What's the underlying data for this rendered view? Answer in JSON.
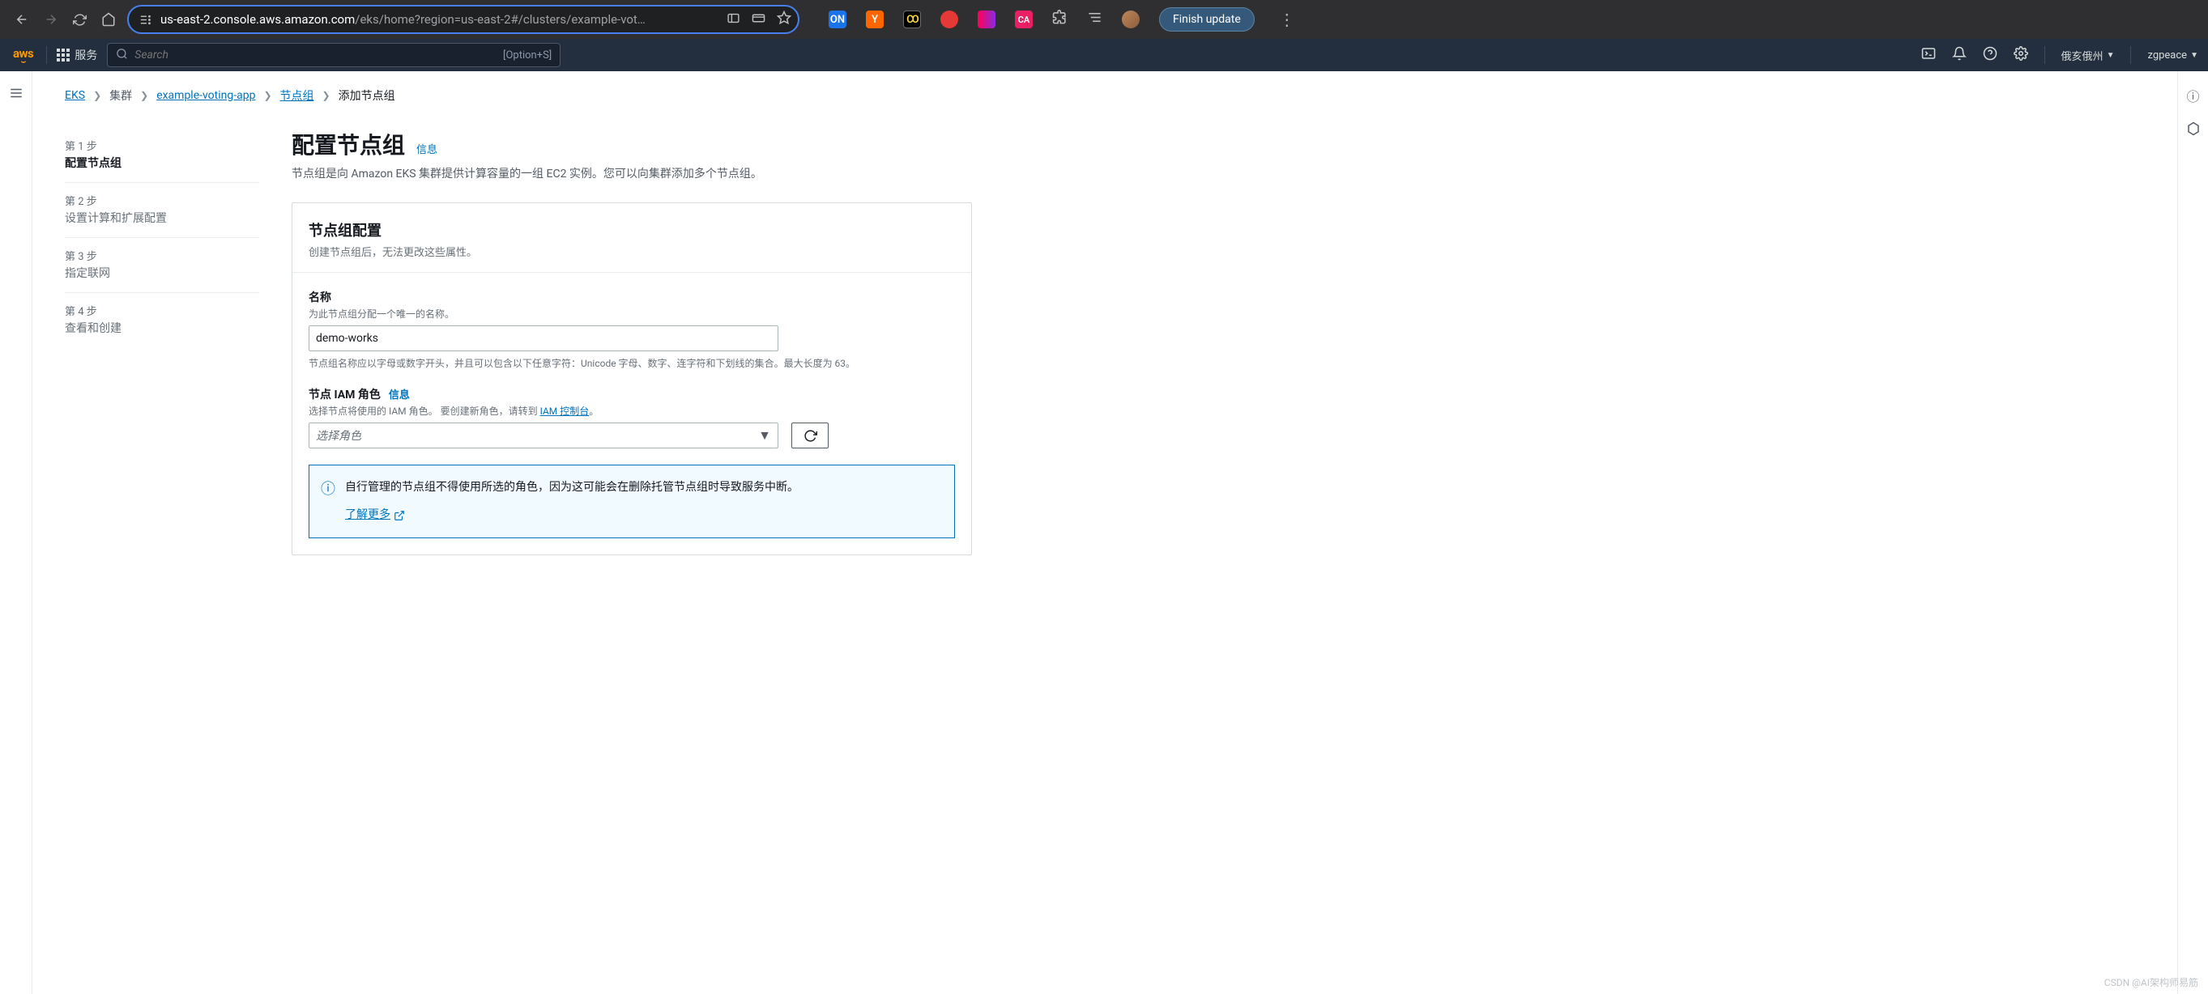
{
  "browser": {
    "url_prefix": "us-east-2.console.aws.amazon.com",
    "url_suffix": "/eks/home?region=us-east-2#/clusters/example-vot…",
    "finish_update": "Finish update"
  },
  "aws_header": {
    "services": "服务",
    "search_placeholder": "Search",
    "search_shortcut": "[Option+S]",
    "region": "俄亥俄州",
    "user": "zgpeace"
  },
  "breadcrumb": {
    "eks": "EKS",
    "clusters": "集群",
    "app": "example-voting-app",
    "nodegroups": "节点组",
    "add": "添加节点组"
  },
  "steps": {
    "s1_num": "第 1 步",
    "s1_title": "配置节点组",
    "s2_num": "第 2 步",
    "s2_title": "设置计算和扩展配置",
    "s3_num": "第 3 步",
    "s3_title": "指定联网",
    "s4_num": "第 4 步",
    "s4_title": "查看和创建"
  },
  "page": {
    "title": "配置节点组",
    "info": "信息",
    "desc": "节点组是向 Amazon EKS 集群提供计算容量的一组 EC2 实例。您可以向集群添加多个节点组。"
  },
  "panel": {
    "title": "节点组配置",
    "subtitle": "创建节点组后，无法更改这些属性。",
    "name_label": "名称",
    "name_hint": "为此节点组分配一个唯一的名称。",
    "name_value": "demo-works",
    "name_constraint": "节点组名称应以字母或数字开头，并且可以包含以下任意字符：Unicode 字母、数字、连字符和下划线的集合。最大长度为 63。",
    "role_label": "节点 IAM 角色",
    "role_info": "信息",
    "role_hint_pre": "选择节点将使用的 IAM 角色。 要创建新角色，请转到 ",
    "role_hint_link": "IAM 控制台",
    "role_hint_post": "。",
    "role_placeholder": "选择角色",
    "alert_text": "自行管理的节点组不得使用所选的角色，因为这可能会在删除托管节点组时导致服务中断。",
    "alert_link": "了解更多"
  },
  "watermark": "CSDN @AI架构师易筋"
}
